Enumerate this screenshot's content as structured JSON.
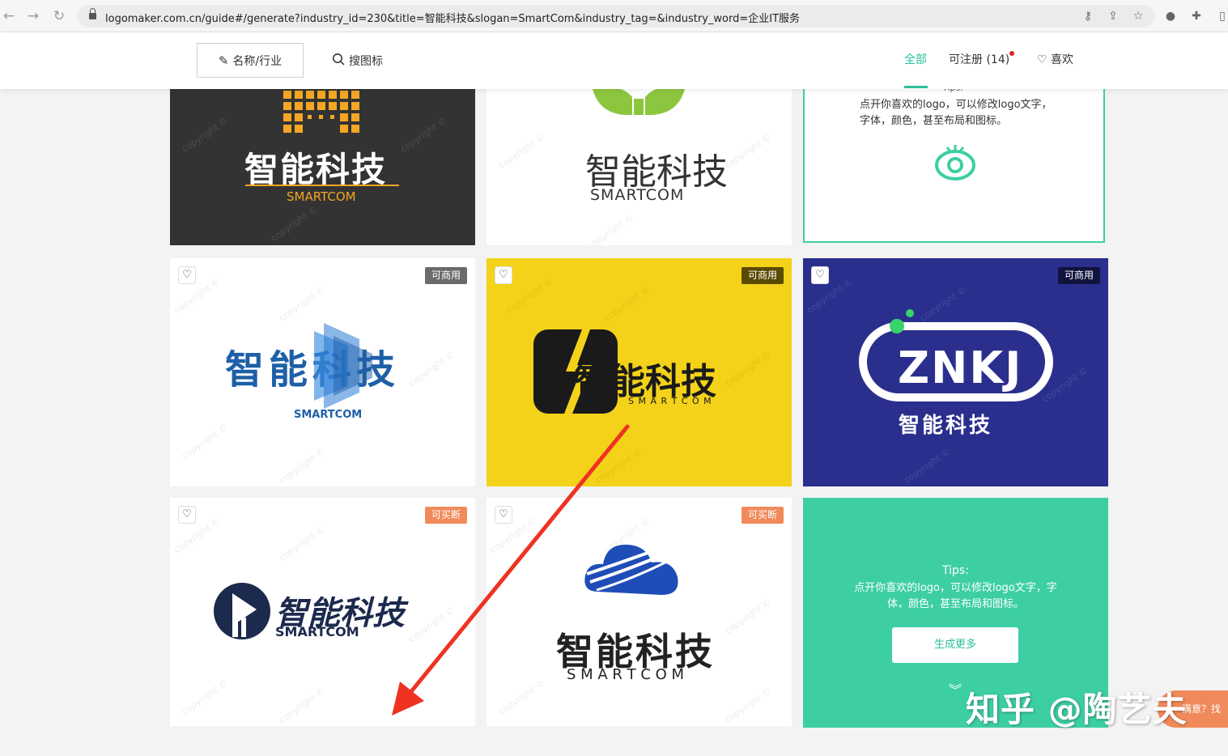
{
  "browser": {
    "url": "logomaker.com.cn/guide#/generate?industry_id=230&title=智能科技&slogan=SmartCom&industry_tag=&industry_word=企业IT服务"
  },
  "header": {
    "tab_name_label": "名称/行业",
    "tab_search_label": "搜图标",
    "filter_all": "全部",
    "filter_registerable": "可注册 (14)",
    "filter_likes": "喜欢"
  },
  "watermark": "copyright ©",
  "logo": {
    "title_cn": "智能科技",
    "slogan_upper": "SMARTCOM",
    "slogan_spaced": "S M A R T C O M",
    "slogan_wide": "S  M  A  R  T  C  O  M",
    "abbrev": "ZNKJ"
  },
  "badges": {
    "commercial": "可商用",
    "buyout": "可买断"
  },
  "tips": {
    "top_heading": "Tips:",
    "top_text": "点开你喜欢的logo，可以修改logo文字，字体，颜色，甚至布局和图标。",
    "bottom_heading": "Tips:",
    "bottom_text_line1": "点开你喜欢的logo，可以修改logo文字，字",
    "bottom_text_line2": "体，颜色，甚至布局和图标。",
    "generate_more": "生成更多"
  },
  "overlay": {
    "zhihu_watermark": "知乎 @陶艺夫",
    "feedback_label": "满意？找"
  },
  "colors": {
    "accent": "#2cc09c",
    "yellow_bg": "#f3d219",
    "navy_bg": "#2a2f8e",
    "dark_bg": "#333333",
    "tips_bg": "#3dcfa3",
    "arrow_red": "#ee3322",
    "badge_gray": "#6b6b6b",
    "badge_orange": "#f08a5a"
  }
}
